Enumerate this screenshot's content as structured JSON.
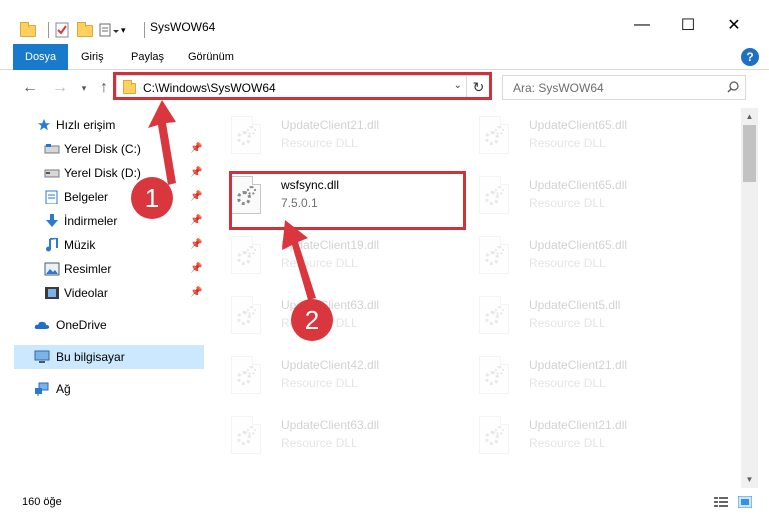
{
  "window": {
    "title": "SysWOW64",
    "minimize": "—",
    "maximize": "☐",
    "close": "✕"
  },
  "ribbon": {
    "tabs": [
      "Dosya",
      "Giriş",
      "Paylaş",
      "Görünüm"
    ]
  },
  "nav": {
    "address": "C:\\Windows\\SysWOW64",
    "search_placeholder": "Ara: SysWOW64"
  },
  "sidebar": {
    "items": [
      {
        "label": "Hızlı erişim",
        "icon": "star-icon"
      },
      {
        "label": "Yerel Disk (C:)",
        "icon": "drive-icon",
        "pinned": true
      },
      {
        "label": "Yerel Disk (D:)",
        "icon": "drive-icon",
        "pinned": true
      },
      {
        "label": "Belgeler",
        "icon": "documents-icon",
        "pinned": true
      },
      {
        "label": "İndirmeler",
        "icon": "download-icon",
        "pinned": true
      },
      {
        "label": "Müzik",
        "icon": "music-icon",
        "pinned": true
      },
      {
        "label": "Resimler",
        "icon": "pictures-icon",
        "pinned": true
      },
      {
        "label": "Videolar",
        "icon": "videos-icon",
        "pinned": true
      },
      {
        "label": "OneDrive",
        "icon": "cloud-icon"
      },
      {
        "label": "Bu bilgisayar",
        "icon": "computer-icon",
        "selected": true
      },
      {
        "label": "Ağ",
        "icon": "network-icon"
      }
    ]
  },
  "files": {
    "col1": [
      {
        "name": "UpdateClient21.dll",
        "type": "Resource DLL"
      },
      {
        "name": "wsfsync.dll",
        "type": "7.5.0.1"
      },
      {
        "name": "UpdateClient19.dll",
        "type": "Resource DLL"
      },
      {
        "name": "UpdateClient63.dll",
        "type": "Resource DLL"
      },
      {
        "name": "UpdateClient42.dll",
        "type": "Resource DLL"
      },
      {
        "name": "UpdateClient63.dll",
        "type": "Resource DLL"
      }
    ],
    "col2": [
      {
        "name": "UpdateClient65.dll",
        "type": "Resource DLL"
      },
      {
        "name": "UpdateClient65.dll",
        "type": "Resource DLL"
      },
      {
        "name": "UpdateClient65.dll",
        "type": "Resource DLL"
      },
      {
        "name": "UpdateClient5.dll",
        "type": "Resource DLL"
      },
      {
        "name": "UpdateClient21.dll",
        "type": "Resource DLL"
      },
      {
        "name": "UpdateClient21.dll",
        "type": "Resource DLL"
      }
    ]
  },
  "status": {
    "count": "160 öğe"
  },
  "annotations": {
    "step1": "1",
    "step2": "2",
    "color": "#d9363e"
  }
}
